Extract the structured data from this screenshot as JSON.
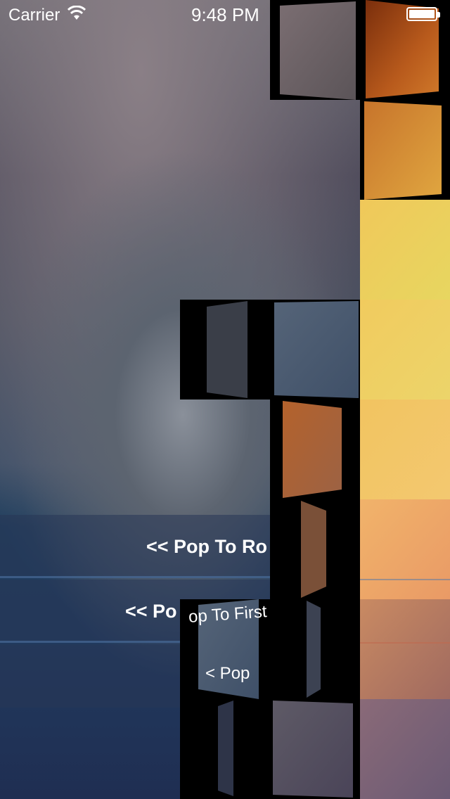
{
  "status_bar": {
    "carrier": "Carrier",
    "time": "9:48 PM",
    "wifi_icon": "wifi-icon",
    "battery_icon": "battery-icon"
  },
  "table": {
    "rows": [
      {
        "label": "<< Pop To Ro"
      },
      {
        "label": "<< Po"
      },
      {
        "label": ""
      }
    ]
  },
  "transition_tiles": {
    "fragment_pop_to_first": "op To First",
    "fragment_pop": "< Pop"
  },
  "colors": {
    "accent_gold": "#f0c85a",
    "accent_orange": "#d98a3a",
    "row_fill": "#28375580",
    "row_divider": "#5078aa"
  }
}
